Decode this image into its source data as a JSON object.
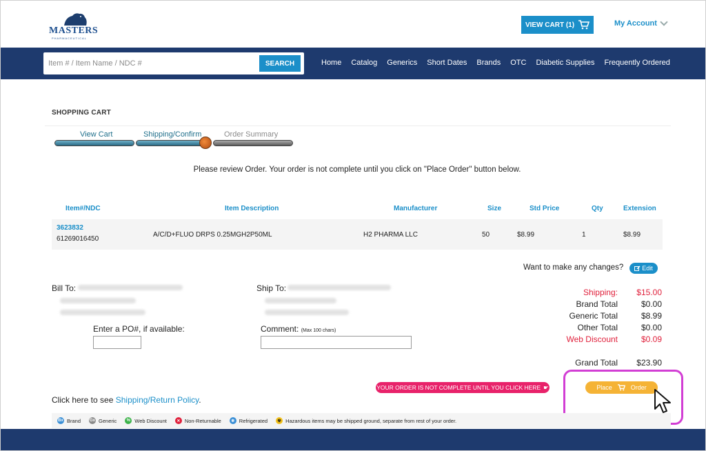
{
  "header": {
    "logo_text": "MASTERS",
    "logo_sub": "PHARMACEUTICAL",
    "view_cart_label": "VIEW CART (1)",
    "account_label": "My Account"
  },
  "search": {
    "placeholder": "Item # / Item Name / NDC #",
    "button_label": "SEARCH"
  },
  "nav": {
    "links": [
      "Home",
      "Catalog",
      "Generics",
      "Short Dates",
      "Brands",
      "OTC",
      "Diabetic Supplies",
      "Frequently Ordered"
    ]
  },
  "cart": {
    "title": "SHOPPING CART",
    "steps": [
      "View Cart",
      "Shipping/Confirm",
      "Order Summary"
    ],
    "notice": "Please review Order. Your order is not complete until you click on \"Place Order\" button below.",
    "columns": [
      "Item#/NDC",
      "Item Description",
      "Manufacturer",
      "Size",
      "Std Price",
      "Qty",
      "Extension"
    ],
    "rows": [
      {
        "item": "3623832",
        "ndc": "61269016450",
        "description": "A/C/D+FLUO DRPS 0.25MGH2P50ML",
        "manufacturer": "H2 PHARMA LLC",
        "size": "50",
        "price": "$8.99",
        "qty": "1",
        "extension": "$8.99"
      }
    ],
    "changes_text": "Want to make any changes?",
    "edit_label": "Edit"
  },
  "addresses": {
    "bill_to_label": "Bill To:",
    "ship_to_label": "Ship To:",
    "po_label": "Enter a PO#, if available:",
    "comment_label": "Comment:",
    "comment_hint": "(Max 100 chars)"
  },
  "totals": [
    {
      "label": "Shipping:",
      "value": "$15.00",
      "highlight": true
    },
    {
      "label": "Brand Total",
      "value": "$0.00",
      "highlight": false
    },
    {
      "label": "Generic Total",
      "value": "$8.99",
      "highlight": false
    },
    {
      "label": "Other Total",
      "value": "$0.00",
      "highlight": false
    },
    {
      "label": "Web Discount",
      "value": "$0.09",
      "highlight": true
    }
  ],
  "grand_total": {
    "label": "Grand Total",
    "value": "$23.90"
  },
  "warning_text": "YOUR ORDER IS NOT COMPLETE UNTIL YOU CLICK HERE",
  "place_order": {
    "left": "Place",
    "right": "Order"
  },
  "policy": {
    "prefix": "Click here to see ",
    "link": "Shipping/Return Policy",
    "suffix": "."
  },
  "legend": [
    {
      "badge": "Bx",
      "label": "Brand",
      "color": "#3a8fd6"
    },
    {
      "badge": "Gx",
      "label": "Generic",
      "color": "#8a8a8a"
    },
    {
      "badge": "%",
      "label": "Web Discount",
      "color": "#3cb34a"
    },
    {
      "badge": "✕",
      "label": "Non-Returnable",
      "color": "#e0213c"
    },
    {
      "badge": "❄",
      "label": "Refrigerated",
      "color": "#3a8fd6"
    },
    {
      "badge": "☢",
      "label": "Hazardous items may be shipped ground, separate from rest of your order.",
      "color": "#f3c11a"
    }
  ],
  "colors": {
    "accent": "#1b8fc9",
    "navbar": "#1e3a6e",
    "warning": "#e8226a",
    "place_order": "#f5b335",
    "highlight": "#d23ed4",
    "discount_red": "#e0213c"
  }
}
